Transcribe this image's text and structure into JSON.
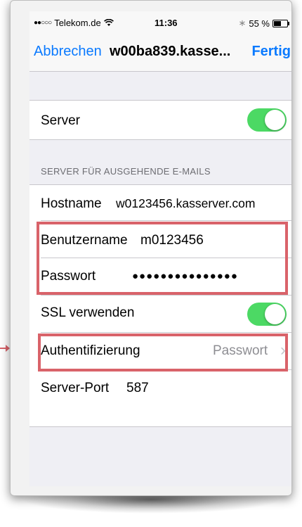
{
  "status_bar": {
    "signal_dots": "●●○○○",
    "carrier": "Telekom.de",
    "wifi_icon": "wifi-icon",
    "time": "11:36",
    "bluetooth": "∗",
    "battery_percent": "55 %"
  },
  "nav": {
    "cancel_label": "Abbrechen",
    "title": "w00ba839.kasse...",
    "done_label": "Fertig"
  },
  "server_row": {
    "label": "Server",
    "enabled": true
  },
  "outgoing_section": {
    "header": "SERVER FÜR AUSGEHENDE E-MAILS",
    "hostname": {
      "label": "Hostname",
      "value": "w0123456.kasserver.com"
    },
    "username": {
      "label": "Benutzername",
      "value": "m0123456"
    },
    "password": {
      "label": "Passwort",
      "value": "●●●●●●●●●●●●●●●"
    },
    "ssl": {
      "label": "SSL verwenden",
      "enabled": true
    },
    "auth": {
      "label": "Authentifizierung",
      "value": "Passwort",
      "chevron": "›"
    },
    "port": {
      "label": "Server-Port",
      "value": "587"
    }
  },
  "annotation_color": "#d9636a",
  "accent_color": "#0a7aff",
  "toggle_color": "#4cd964"
}
